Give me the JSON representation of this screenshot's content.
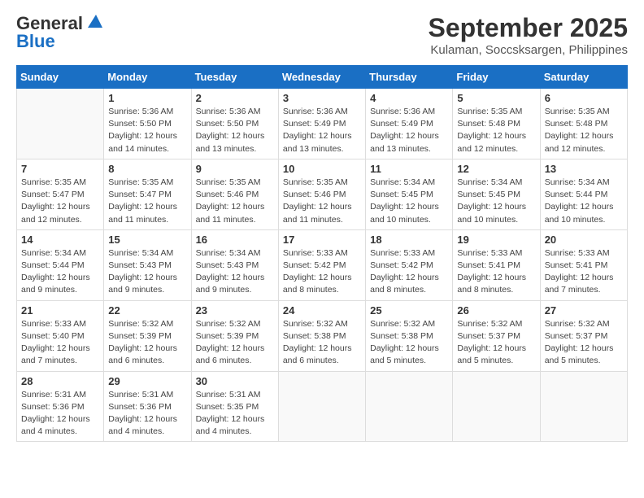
{
  "logo": {
    "line1": "General",
    "line2": "Blue"
  },
  "title": "September 2025",
  "subtitle": "Kulaman, Soccsksargen, Philippines",
  "days_header": [
    "Sunday",
    "Monday",
    "Tuesday",
    "Wednesday",
    "Thursday",
    "Friday",
    "Saturday"
  ],
  "weeks": [
    [
      {
        "day": "",
        "info": ""
      },
      {
        "day": "1",
        "info": "Sunrise: 5:36 AM\nSunset: 5:50 PM\nDaylight: 12 hours\nand 14 minutes."
      },
      {
        "day": "2",
        "info": "Sunrise: 5:36 AM\nSunset: 5:50 PM\nDaylight: 12 hours\nand 13 minutes."
      },
      {
        "day": "3",
        "info": "Sunrise: 5:36 AM\nSunset: 5:49 PM\nDaylight: 12 hours\nand 13 minutes."
      },
      {
        "day": "4",
        "info": "Sunrise: 5:36 AM\nSunset: 5:49 PM\nDaylight: 12 hours\nand 13 minutes."
      },
      {
        "day": "5",
        "info": "Sunrise: 5:35 AM\nSunset: 5:48 PM\nDaylight: 12 hours\nand 12 minutes."
      },
      {
        "day": "6",
        "info": "Sunrise: 5:35 AM\nSunset: 5:48 PM\nDaylight: 12 hours\nand 12 minutes."
      }
    ],
    [
      {
        "day": "7",
        "info": "Sunrise: 5:35 AM\nSunset: 5:47 PM\nDaylight: 12 hours\nand 12 minutes."
      },
      {
        "day": "8",
        "info": "Sunrise: 5:35 AM\nSunset: 5:47 PM\nDaylight: 12 hours\nand 11 minutes."
      },
      {
        "day": "9",
        "info": "Sunrise: 5:35 AM\nSunset: 5:46 PM\nDaylight: 12 hours\nand 11 minutes."
      },
      {
        "day": "10",
        "info": "Sunrise: 5:35 AM\nSunset: 5:46 PM\nDaylight: 12 hours\nand 11 minutes."
      },
      {
        "day": "11",
        "info": "Sunrise: 5:34 AM\nSunset: 5:45 PM\nDaylight: 12 hours\nand 10 minutes."
      },
      {
        "day": "12",
        "info": "Sunrise: 5:34 AM\nSunset: 5:45 PM\nDaylight: 12 hours\nand 10 minutes."
      },
      {
        "day": "13",
        "info": "Sunrise: 5:34 AM\nSunset: 5:44 PM\nDaylight: 12 hours\nand 10 minutes."
      }
    ],
    [
      {
        "day": "14",
        "info": "Sunrise: 5:34 AM\nSunset: 5:44 PM\nDaylight: 12 hours\nand 9 minutes."
      },
      {
        "day": "15",
        "info": "Sunrise: 5:34 AM\nSunset: 5:43 PM\nDaylight: 12 hours\nand 9 minutes."
      },
      {
        "day": "16",
        "info": "Sunrise: 5:34 AM\nSunset: 5:43 PM\nDaylight: 12 hours\nand 9 minutes."
      },
      {
        "day": "17",
        "info": "Sunrise: 5:33 AM\nSunset: 5:42 PM\nDaylight: 12 hours\nand 8 minutes."
      },
      {
        "day": "18",
        "info": "Sunrise: 5:33 AM\nSunset: 5:42 PM\nDaylight: 12 hours\nand 8 minutes."
      },
      {
        "day": "19",
        "info": "Sunrise: 5:33 AM\nSunset: 5:41 PM\nDaylight: 12 hours\nand 8 minutes."
      },
      {
        "day": "20",
        "info": "Sunrise: 5:33 AM\nSunset: 5:41 PM\nDaylight: 12 hours\nand 7 minutes."
      }
    ],
    [
      {
        "day": "21",
        "info": "Sunrise: 5:33 AM\nSunset: 5:40 PM\nDaylight: 12 hours\nand 7 minutes."
      },
      {
        "day": "22",
        "info": "Sunrise: 5:32 AM\nSunset: 5:39 PM\nDaylight: 12 hours\nand 6 minutes."
      },
      {
        "day": "23",
        "info": "Sunrise: 5:32 AM\nSunset: 5:39 PM\nDaylight: 12 hours\nand 6 minutes."
      },
      {
        "day": "24",
        "info": "Sunrise: 5:32 AM\nSunset: 5:38 PM\nDaylight: 12 hours\nand 6 minutes."
      },
      {
        "day": "25",
        "info": "Sunrise: 5:32 AM\nSunset: 5:38 PM\nDaylight: 12 hours\nand 5 minutes."
      },
      {
        "day": "26",
        "info": "Sunrise: 5:32 AM\nSunset: 5:37 PM\nDaylight: 12 hours\nand 5 minutes."
      },
      {
        "day": "27",
        "info": "Sunrise: 5:32 AM\nSunset: 5:37 PM\nDaylight: 12 hours\nand 5 minutes."
      }
    ],
    [
      {
        "day": "28",
        "info": "Sunrise: 5:31 AM\nSunset: 5:36 PM\nDaylight: 12 hours\nand 4 minutes."
      },
      {
        "day": "29",
        "info": "Sunrise: 5:31 AM\nSunset: 5:36 PM\nDaylight: 12 hours\nand 4 minutes."
      },
      {
        "day": "30",
        "info": "Sunrise: 5:31 AM\nSunset: 5:35 PM\nDaylight: 12 hours\nand 4 minutes."
      },
      {
        "day": "",
        "info": ""
      },
      {
        "day": "",
        "info": ""
      },
      {
        "day": "",
        "info": ""
      },
      {
        "day": "",
        "info": ""
      }
    ]
  ]
}
